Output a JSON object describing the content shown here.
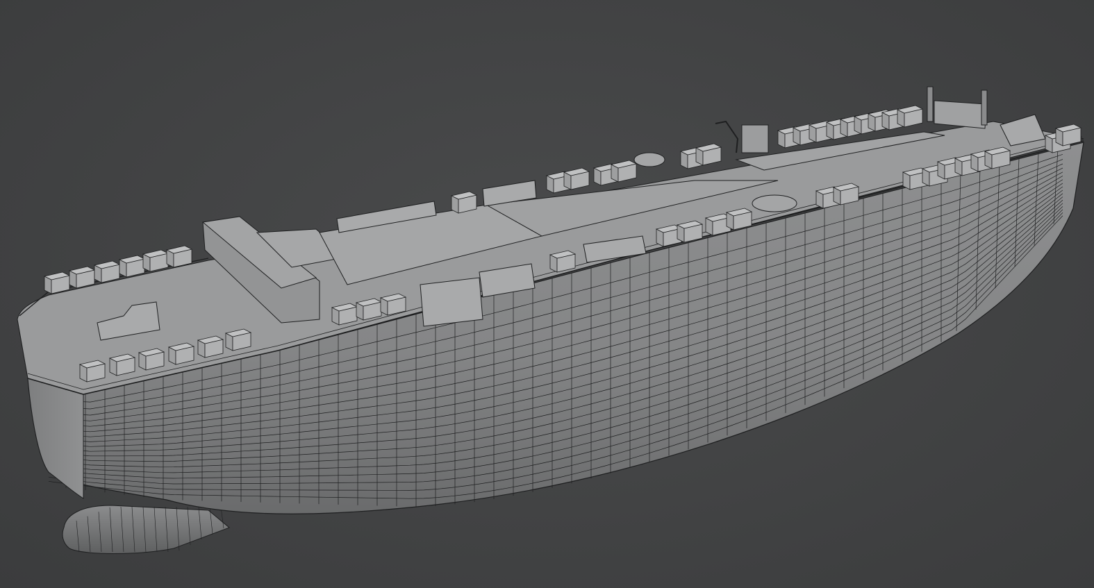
{
  "scene": {
    "subject": "ship-hull-wireframe",
    "background_color": "#424344",
    "hull_fill_color": "#8a8b8c",
    "hull_shadow_color": "#6e6f70",
    "deck_fill_color": "#9a9b9c",
    "wire_color": "#1e1f20",
    "container_fill_color": "#b4b5b6"
  }
}
